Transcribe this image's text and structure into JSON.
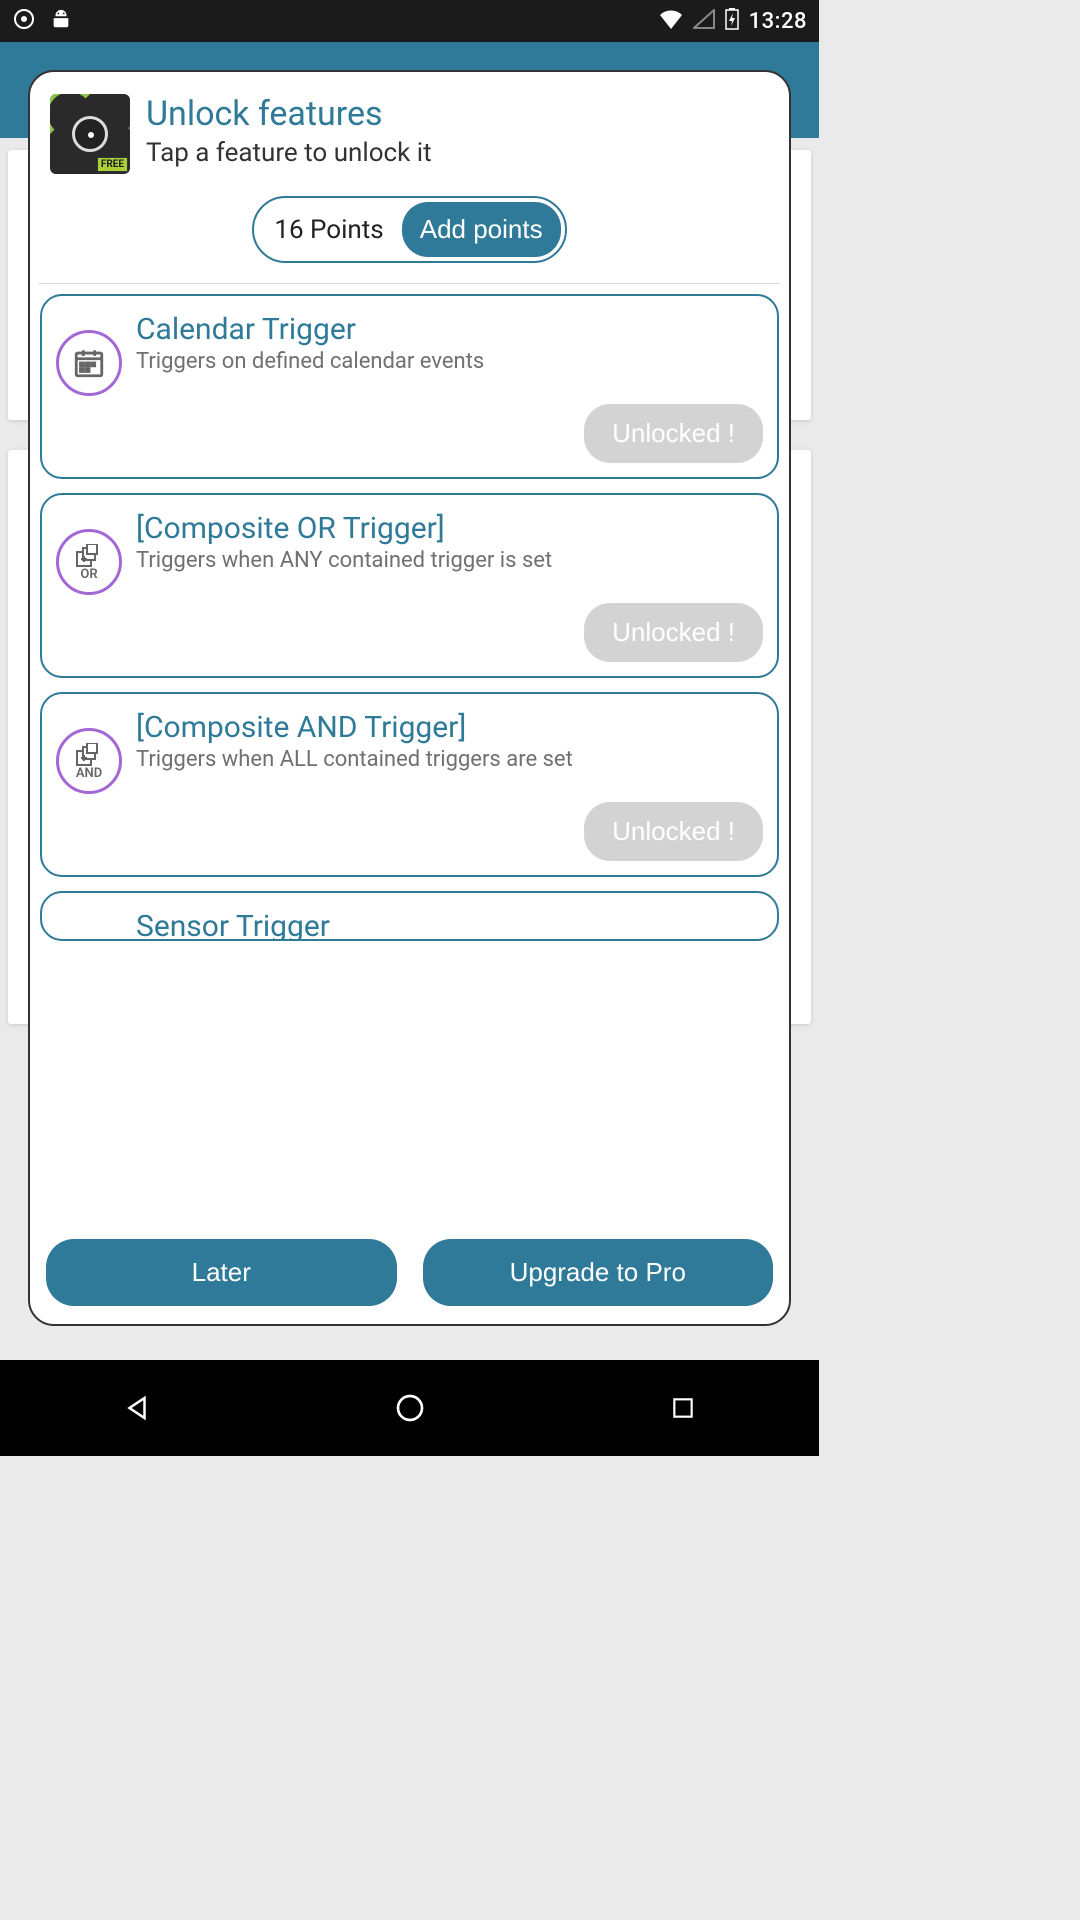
{
  "status": {
    "time": "13:28"
  },
  "dialog": {
    "title": "Unlock features",
    "subtitle": "Tap a feature to unlock it",
    "app_badge": "FREE",
    "points_label": "16 Points",
    "add_points_label": "Add points"
  },
  "features": [
    {
      "icon_sub": "",
      "title": "Calendar Trigger",
      "desc": "Triggers on defined calendar events",
      "status": "Unlocked !"
    },
    {
      "icon_sub": "OR",
      "title": "[Composite OR Trigger]",
      "desc": "Triggers when ANY contained trigger is set",
      "status": "Unlocked !"
    },
    {
      "icon_sub": "AND",
      "title": "[Composite AND Trigger]",
      "desc": "Triggers when ALL contained triggers are set",
      "status": "Unlocked !"
    },
    {
      "icon_sub": "",
      "title": "Sensor Trigger",
      "desc": "",
      "status": ""
    }
  ],
  "footer": {
    "later": "Later",
    "upgrade": "Upgrade to Pro"
  }
}
